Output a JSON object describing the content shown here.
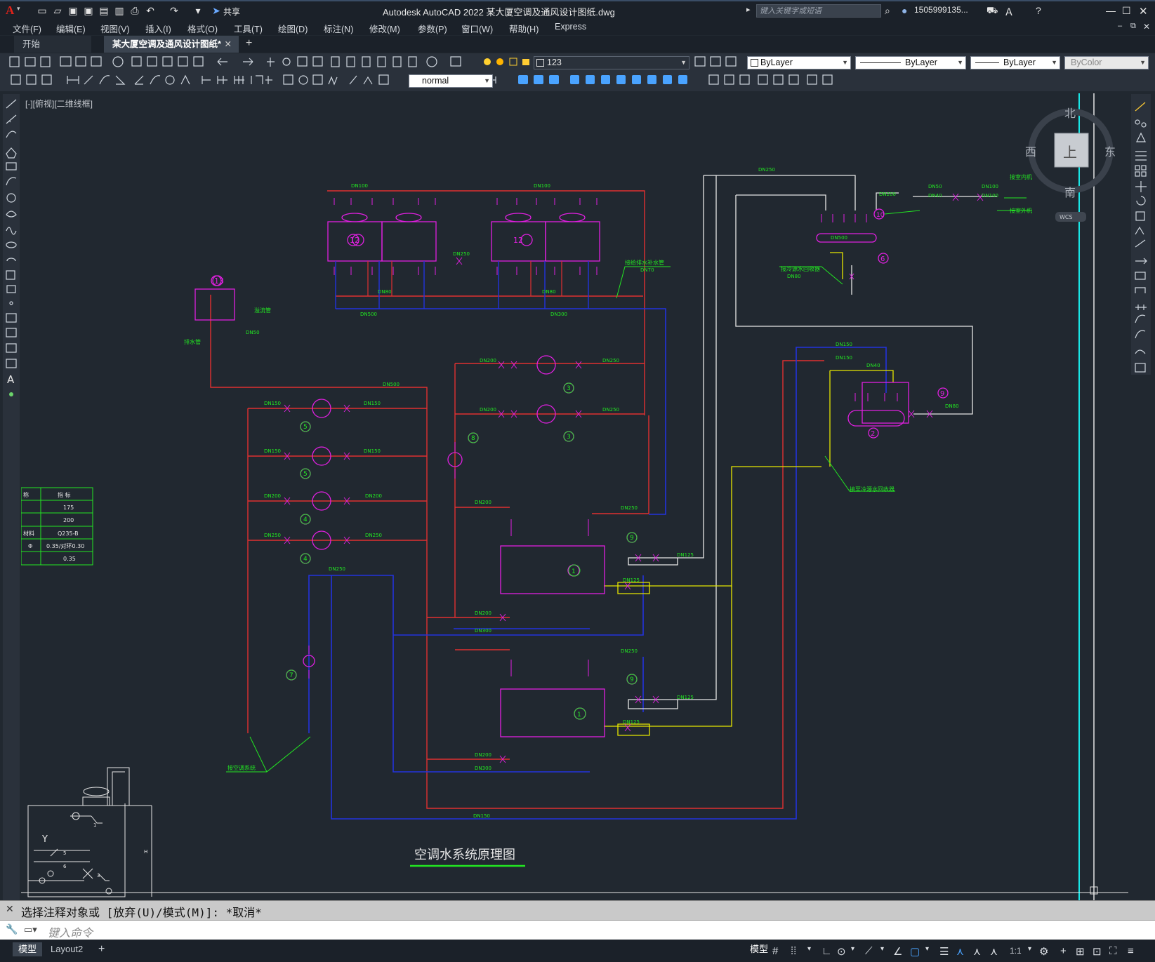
{
  "app": {
    "title": "Autodesk AutoCAD 2022    某大厦空调及通风设计图纸.dwg",
    "search_placeholder": "键入关键字或短语",
    "user": "1505999135...",
    "logo": "A"
  },
  "menu": [
    "文件(F)",
    "编辑(E)",
    "视图(V)",
    "插入(I)",
    "格式(O)",
    "工具(T)",
    "绘图(D)",
    "标注(N)",
    "修改(M)",
    "参数(P)",
    "窗口(W)",
    "帮助(H)",
    "Express"
  ],
  "share_label": "共享",
  "tabs": {
    "start": "开始",
    "doc": "某大厦空调及通风设计图纸*"
  },
  "toolbar": {
    "layer": "123",
    "color": "ByLayer",
    "linetype": "ByLayer",
    "lineweight": "ByLayer",
    "plotstyle": "ByColor",
    "dimstyle": "normal"
  },
  "viewport_label": "[-][俯视][二维线框]",
  "viewcube": {
    "north": "北",
    "south": "南",
    "east": "东",
    "west": "西",
    "top": "上",
    "wcs": "WCS"
  },
  "drawing": {
    "title": "空调水系统原理图",
    "table_rows": [
      [
        "称",
        "指  标"
      ],
      [
        "",
        "175"
      ],
      [
        "",
        "200"
      ],
      [
        "材料",
        "Q235-B"
      ],
      [
        "Φ",
        "0.35/对环0.30"
      ],
      [
        "",
        "0.35"
      ]
    ],
    "pipe_labels": {
      "a": "DN100",
      "b": "DN500",
      "c": "DN300",
      "d": "DN150",
      "e": "DN250",
      "f": "DN200",
      "g": "DN50",
      "h": "DN80",
      "i": "DN70",
      "j": "DN40",
      "k": "DN125"
    },
    "notes": {
      "n1": "接给排水补水管",
      "n2": "接至冷源水回收器",
      "n3": "接室内机",
      "n4": "接室外机",
      "n5": "接冷源水回收器",
      "n6": "接空调系统",
      "n7": "溢流管",
      "n8": "排水管"
    },
    "equipment_numbers": [
      "①",
      "②",
      "③",
      "④",
      "⑤",
      "⑥",
      "⑦",
      "⑧",
      "⑨",
      "⑩",
      "⑫",
      "⑬"
    ]
  },
  "command": {
    "history": "选择注释对象或 [放弃(U)/模式(M)]: *取消*",
    "placeholder": "键入命令"
  },
  "status": {
    "tab_model": "模型",
    "tab_layout": "Layout2",
    "space": "模型",
    "scale": "1:1"
  }
}
